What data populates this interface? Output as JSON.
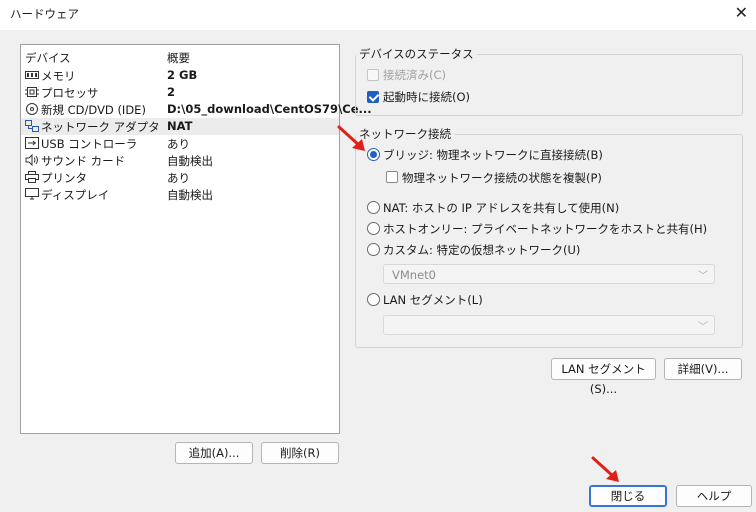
{
  "window": {
    "title": "ハードウェア"
  },
  "device_list": {
    "headers": {
      "device": "デバイス",
      "summary": "概要"
    },
    "rows": [
      {
        "name": "メモリ",
        "summary": "2 GB",
        "icon": "memory-icon"
      },
      {
        "name": "プロセッサ",
        "summary": "2",
        "icon": "processor-icon"
      },
      {
        "name": "新規 CD/DVD (IDE)",
        "summary": "D:\\05_download\\CentOS79\\Ce...",
        "icon": "cd-dvd-icon"
      },
      {
        "name": "ネットワーク アダプタ",
        "summary": "NAT",
        "icon": "network-adapter-icon",
        "selected": true
      },
      {
        "name": "USB コントローラ",
        "summary": "あり",
        "icon": "usb-icon"
      },
      {
        "name": "サウンド カード",
        "summary": "自動検出",
        "icon": "sound-icon"
      },
      {
        "name": "プリンタ",
        "summary": "あり",
        "icon": "printer-icon"
      },
      {
        "name": "ディスプレイ",
        "summary": "自動検出",
        "icon": "display-icon"
      }
    ]
  },
  "buttons": {
    "add": "追加(A)...",
    "remove": "削除(R)",
    "lan_segment": "LAN セグメント(S)...",
    "advanced": "詳細(V)...",
    "close": "閉じる",
    "help": "ヘルプ"
  },
  "device_status": {
    "title": "デバイスのステータス",
    "connected": {
      "label": "接続済み(C)",
      "checked": false,
      "disabled": true
    },
    "connect_at_power_on": {
      "label": "起動時に接続(O)",
      "checked": true
    }
  },
  "network_connection": {
    "title": "ネットワーク接続",
    "bridged": {
      "label": "ブリッジ: 物理ネットワークに直接接続(B)",
      "checked": true
    },
    "replicate": {
      "label": "物理ネットワーク接続の状態を複製(P)",
      "checked": false
    },
    "nat": {
      "label": "NAT: ホストの IP アドレスを共有して使用(N)",
      "checked": false
    },
    "host_only": {
      "label": "ホストオンリー: プライベートネットワークをホストと共有(H)",
      "checked": false
    },
    "custom": {
      "label": "カスタム: 特定の仮想ネットワーク(U)",
      "checked": false
    },
    "custom_select": "VMnet0",
    "lan_segment": {
      "label": "LAN セグメント(L)",
      "checked": false
    },
    "lan_select": ""
  },
  "colors": {
    "accent": "#1f5fbf",
    "annotation_arrow": "#e0201b"
  }
}
